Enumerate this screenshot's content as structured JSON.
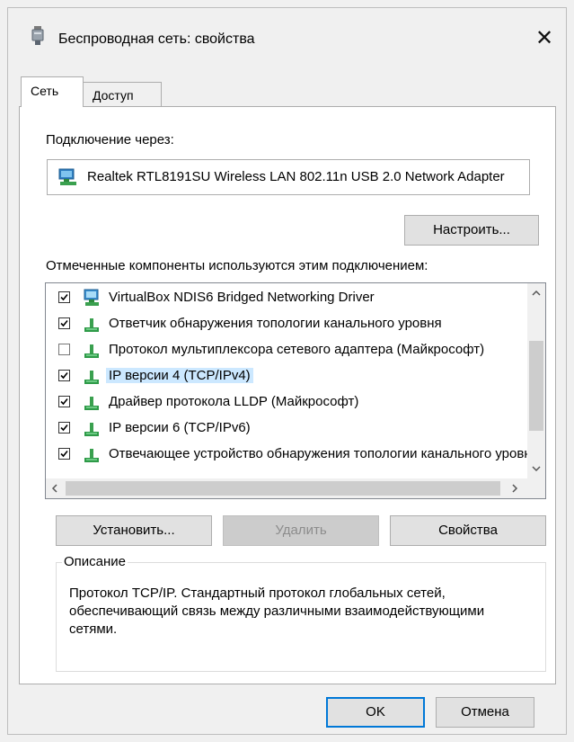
{
  "window": {
    "title": "Беспроводная сеть: свойства",
    "close_symbol": "✕"
  },
  "tabs": [
    {
      "label": "Сеть",
      "active": true
    },
    {
      "label": "Доступ",
      "active": false
    }
  ],
  "connection": {
    "label": "Подключение через:",
    "adapter": "Realtek RTL8191SU Wireless LAN 802.11n USB 2.0 Network Adapter",
    "configure_button": "Настроить..."
  },
  "components": {
    "label": "Отмеченные компоненты используются этим подключением:",
    "items": [
      {
        "label": "VirtualBox NDIS6 Bridged Networking Driver",
        "checked": true,
        "icon": "network-driver-icon"
      },
      {
        "label": "Ответчик обнаружения топологии канального уровня",
        "checked": true,
        "icon": "protocol-icon"
      },
      {
        "label": "Протокол мультиплексора сетевого адаптера (Майкрософт)",
        "checked": false,
        "icon": "protocol-icon"
      },
      {
        "label": "IP версии 4 (TCP/IPv4)",
        "checked": true,
        "icon": "protocol-icon",
        "selected": true
      },
      {
        "label": "Драйвер протокола LLDP (Майкрософт)",
        "checked": true,
        "icon": "protocol-icon"
      },
      {
        "label": "IP версии 6 (TCP/IPv6)",
        "checked": true,
        "icon": "protocol-icon"
      },
      {
        "label": "Отвечающее устройство обнаружения топологии канального уровня",
        "checked": true,
        "icon": "protocol-icon"
      }
    ]
  },
  "actions": {
    "install": "Установить...",
    "remove": "Удалить",
    "properties": "Свойства"
  },
  "description": {
    "title": "Описание",
    "text": "Протокол TCP/IP. Стандартный протокол глобальных сетей, обеспечивающий связь между различными взаимодействующими сетями."
  },
  "footer": {
    "ok": "OK",
    "cancel": "Отмена"
  },
  "colors": {
    "accent": "#0078d7",
    "selection": "#cce8ff",
    "window_bg": "#f0f0f0"
  }
}
